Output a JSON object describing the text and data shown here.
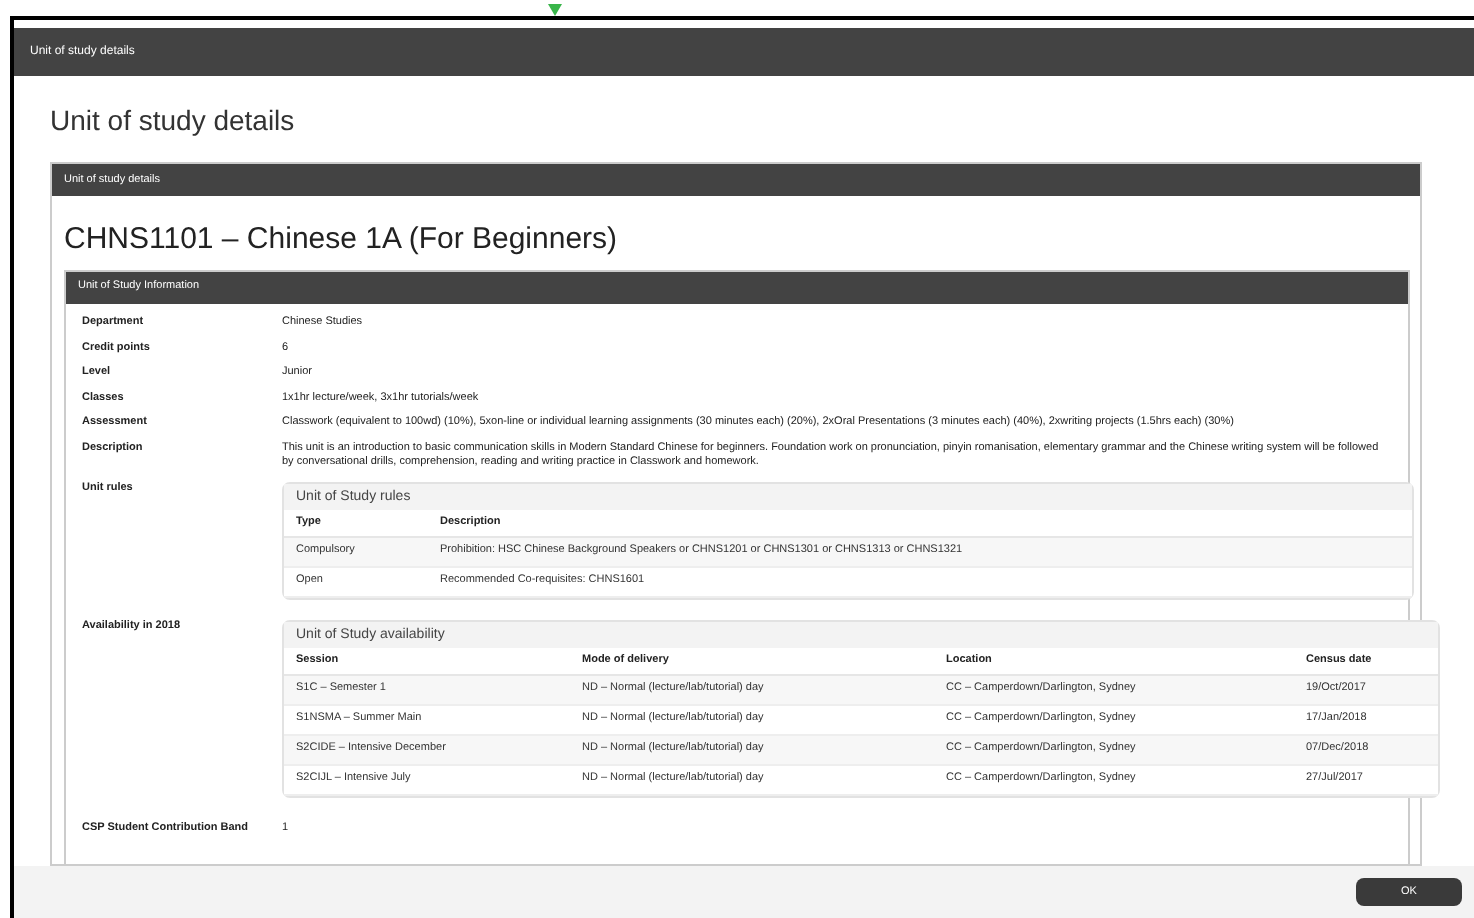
{
  "window": {
    "title": "Unit of study details"
  },
  "page_title": "Unit of study details",
  "panel": {
    "title": "Unit of study details",
    "unit_heading": "CHNS1101 – Chinese 1A (For Beginners)",
    "info_title": "Unit of Study Information"
  },
  "fields": [
    {
      "label": "Department",
      "value": "Chinese Studies"
    },
    {
      "label": "Credit points",
      "value": "6"
    },
    {
      "label": "Level",
      "value": "Junior"
    },
    {
      "label": "Classes",
      "value": "1x1hr lecture/week, 3x1hr tutorials/week"
    },
    {
      "label": "Assessment",
      "value": "Classwork (equivalent to 100wd) (10%), 5xon-line or individual learning assignments (30 minutes each) (20%), 2xOral Presentations (3 minutes each) (40%), 2xwriting projects (1.5hrs each) (30%)"
    },
    {
      "label": "Description",
      "value": "This unit is an introduction to basic communication skills in Modern Standard Chinese for beginners. Foundation work on pronunciation, pinyin romanisation, elementary grammar and the Chinese writing system will be followed by conversational drills, comprehension, reading and writing practice in Classwork and homework."
    }
  ],
  "rules": {
    "label": "Unit rules",
    "title": "Unit of Study rules",
    "columns": [
      "Type",
      "Description"
    ],
    "rows": [
      [
        "Compulsory",
        "Prohibition: HSC Chinese Background Speakers or CHNS1201 or CHNS1301 or CHNS1313 or CHNS1321"
      ],
      [
        "Open",
        "Recommended Co-requisites: CHNS1601"
      ]
    ]
  },
  "availability": {
    "label": "Availability in 2018",
    "title": "Unit of Study availability",
    "columns": [
      "Session",
      "Mode of delivery",
      "Location",
      "Census date"
    ],
    "rows": [
      [
        "S1C – Semester 1",
        "ND – Normal (lecture/lab/tutorial) day",
        "CC – Camperdown/Darlington, Sydney",
        "19/Oct/2017"
      ],
      [
        "S1NSMA – Summer Main",
        "ND – Normal (lecture/lab/tutorial) day",
        "CC – Camperdown/Darlington, Sydney",
        "17/Jan/2018"
      ],
      [
        "S2CIDE – Intensive December",
        "ND – Normal (lecture/lab/tutorial) day",
        "CC – Camperdown/Darlington, Sydney",
        "07/Dec/2018"
      ],
      [
        "S2CIJL – Intensive July",
        "ND – Normal (lecture/lab/tutorial) day",
        "CC – Camperdown/Darlington, Sydney",
        "27/Jul/2017"
      ]
    ]
  },
  "band": {
    "label": "CSP Student Contribution Band",
    "value": "1"
  },
  "buttons": [
    "OK"
  ]
}
